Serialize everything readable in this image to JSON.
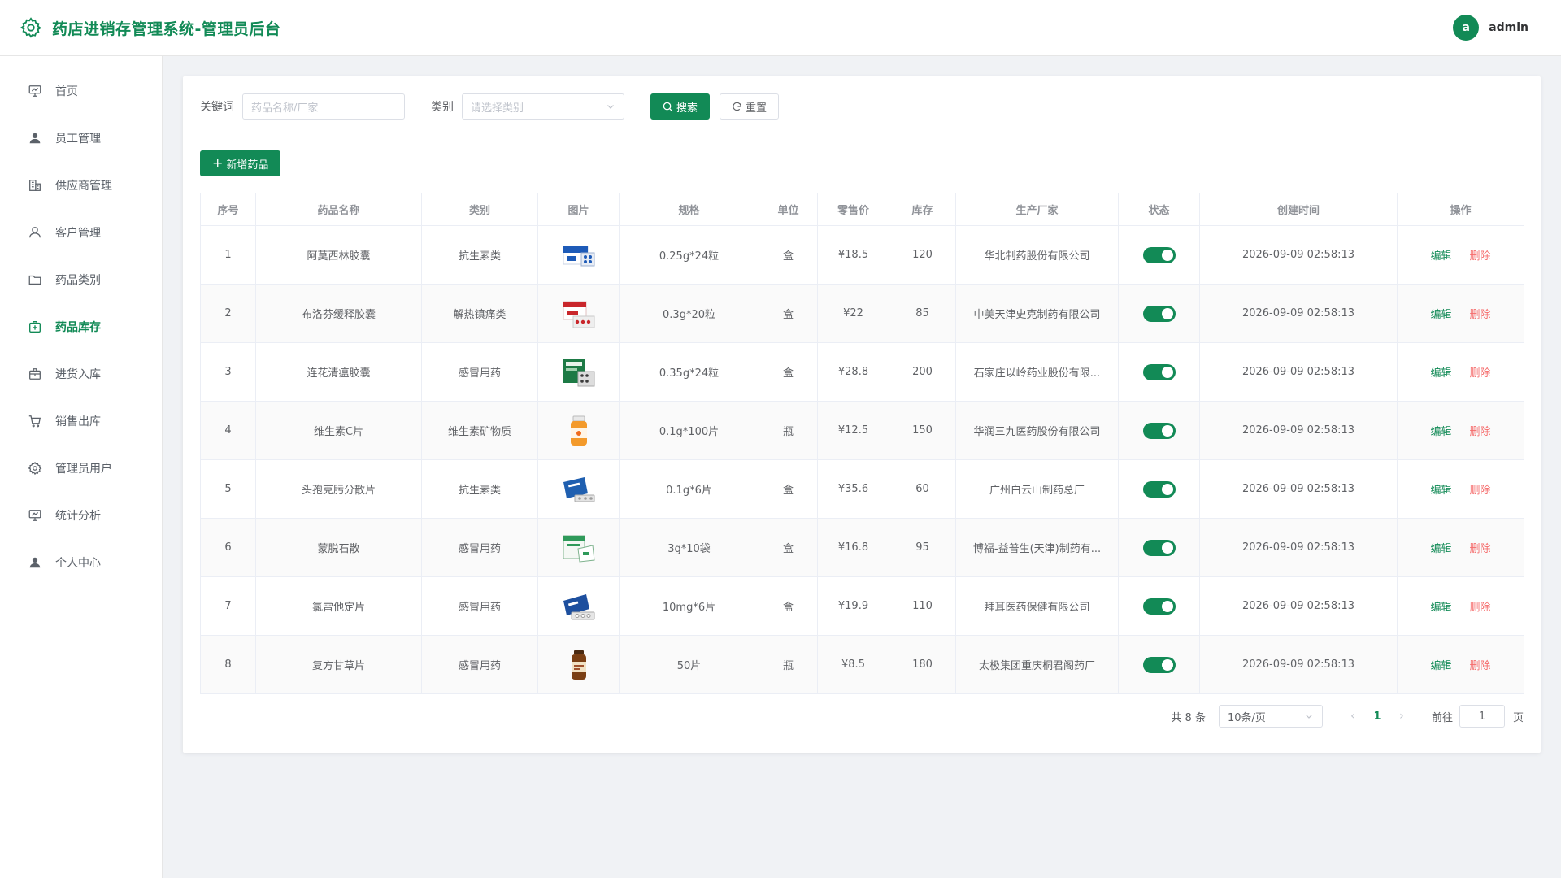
{
  "header": {
    "title": "药店进销存管理系统-管理员后台",
    "avatar_letter": "a",
    "user_name": "admin",
    "brand_color": "#128a56"
  },
  "sidebar": {
    "items": [
      {
        "label": "首页",
        "icon": "dashboard-icon",
        "active": false
      },
      {
        "label": "员工管理",
        "icon": "user-icon",
        "active": false
      },
      {
        "label": "供应商管理",
        "icon": "building-icon",
        "active": false
      },
      {
        "label": "客户管理",
        "icon": "person-icon",
        "active": false
      },
      {
        "label": "药品类别",
        "icon": "folder-icon",
        "active": false
      },
      {
        "label": "药品库存",
        "icon": "medical-box-icon",
        "active": true
      },
      {
        "label": "进货入库",
        "icon": "inbox-icon",
        "active": false
      },
      {
        "label": "销售出库",
        "icon": "cart-icon",
        "active": false
      },
      {
        "label": "管理员用户",
        "icon": "gear-icon",
        "active": false
      },
      {
        "label": "统计分析",
        "icon": "chart-icon",
        "active": false
      },
      {
        "label": "个人中心",
        "icon": "user-icon",
        "active": false
      }
    ]
  },
  "search": {
    "keyword_label": "关键词",
    "keyword_placeholder": "药品名称/厂家",
    "category_label": "类别",
    "category_placeholder": "请选择类别",
    "search_button": "搜索",
    "reset_button": "重置"
  },
  "toolbar": {
    "add_button": "新增药品"
  },
  "table": {
    "columns": [
      "序号",
      "药品名称",
      "类别",
      "图片",
      "规格",
      "单位",
      "零售价",
      "库存",
      "生产厂家",
      "状态",
      "创建时间",
      "操作"
    ],
    "edit_label": "编辑",
    "delete_label": "删除",
    "rows": [
      {
        "no": "1",
        "name": "阿莫西林胶囊",
        "category": "抗生素类",
        "image": "blue-box-pills",
        "spec": "0.25g*24粒",
        "unit": "盒",
        "price": "¥18.5",
        "stock": "120",
        "maker": "华北制药股份有限公司",
        "enabled": true,
        "created": "2026-09-09 02:58:13"
      },
      {
        "no": "2",
        "name": "布洛芬缓释胶囊",
        "category": "解热镇痛类",
        "image": "red-box-pills",
        "spec": "0.3g*20粒",
        "unit": "盒",
        "price": "¥22",
        "stock": "85",
        "maker": "中美天津史克制药有限公司",
        "enabled": true,
        "created": "2026-09-09 02:58:13"
      },
      {
        "no": "3",
        "name": "连花清瘟胶囊",
        "category": "感冒用药",
        "image": "green-box-pills",
        "spec": "0.35g*24粒",
        "unit": "盒",
        "price": "¥28.8",
        "stock": "200",
        "maker": "石家庄以岭药业股份有限...",
        "enabled": true,
        "created": "2026-09-09 02:58:13"
      },
      {
        "no": "4",
        "name": "维生素C片",
        "category": "维生素矿物质",
        "image": "orange-bottle",
        "spec": "0.1g*100片",
        "unit": "瓶",
        "price": "¥12.5",
        "stock": "150",
        "maker": "华润三九医药股份有限公司",
        "enabled": true,
        "created": "2026-09-09 02:58:13"
      },
      {
        "no": "5",
        "name": "头孢克肟分散片",
        "category": "抗生素类",
        "image": "blue-box-tablets",
        "spec": "0.1g*6片",
        "unit": "盒",
        "price": "¥35.6",
        "stock": "60",
        "maker": "广州白云山制药总厂",
        "enabled": true,
        "created": "2026-09-09 02:58:13"
      },
      {
        "no": "6",
        "name": "蒙脱石散",
        "category": "感冒用药",
        "image": "green-white-box",
        "spec": "3g*10袋",
        "unit": "盒",
        "price": "¥16.8",
        "stock": "95",
        "maker": "博福-益普生(天津)制药有...",
        "enabled": true,
        "created": "2026-09-09 02:58:13"
      },
      {
        "no": "7",
        "name": "氯雷他定片",
        "category": "感冒用药",
        "image": "blue-box-blister",
        "spec": "10mg*6片",
        "unit": "盒",
        "price": "¥19.9",
        "stock": "110",
        "maker": "拜耳医药保健有限公司",
        "enabled": true,
        "created": "2026-09-09 02:58:13"
      },
      {
        "no": "8",
        "name": "复方甘草片",
        "category": "感冒用药",
        "image": "brown-bottle",
        "spec": "50片",
        "unit": "瓶",
        "price": "¥8.5",
        "stock": "180",
        "maker": "太极集团重庆桐君阁药厂",
        "enabled": true,
        "created": "2026-09-09 02:58:13"
      }
    ]
  },
  "pagination": {
    "total_text": "共 8 条",
    "page_size": "10条/页",
    "current_page": "1",
    "goto_label": "前往",
    "goto_value": "1",
    "page_suffix": "页"
  }
}
